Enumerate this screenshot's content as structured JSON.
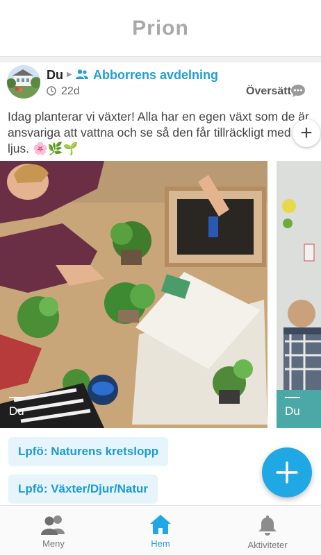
{
  "app": {
    "title": "Prion"
  },
  "post": {
    "author": "Du",
    "group": "Abborrens avdelning",
    "time": "22d",
    "translate_label": "Översätt",
    "text": "Idag planterar vi växter! Alla har en egen växt som de är ansvariga att vattna och se så den får tillräckligt med ljus. 🌸🌿🌱",
    "photos": [
      {
        "caption": "Du"
      },
      {
        "caption": "Du"
      }
    ],
    "tags": [
      "Lpfö: Naturens kretslopp",
      "Lpfö: Växter/Djur/Natur"
    ]
  },
  "nav": {
    "items": [
      {
        "label": "Meny",
        "icon": "people-icon",
        "active": false
      },
      {
        "label": "Hem",
        "icon": "home-icon",
        "active": true
      },
      {
        "label": "Aktiviteter",
        "icon": "bell-icon",
        "active": false
      }
    ]
  },
  "colors": {
    "accent": "#1fa8e3",
    "link": "#1f9fd8",
    "title_gray": "#a9a9a9"
  }
}
